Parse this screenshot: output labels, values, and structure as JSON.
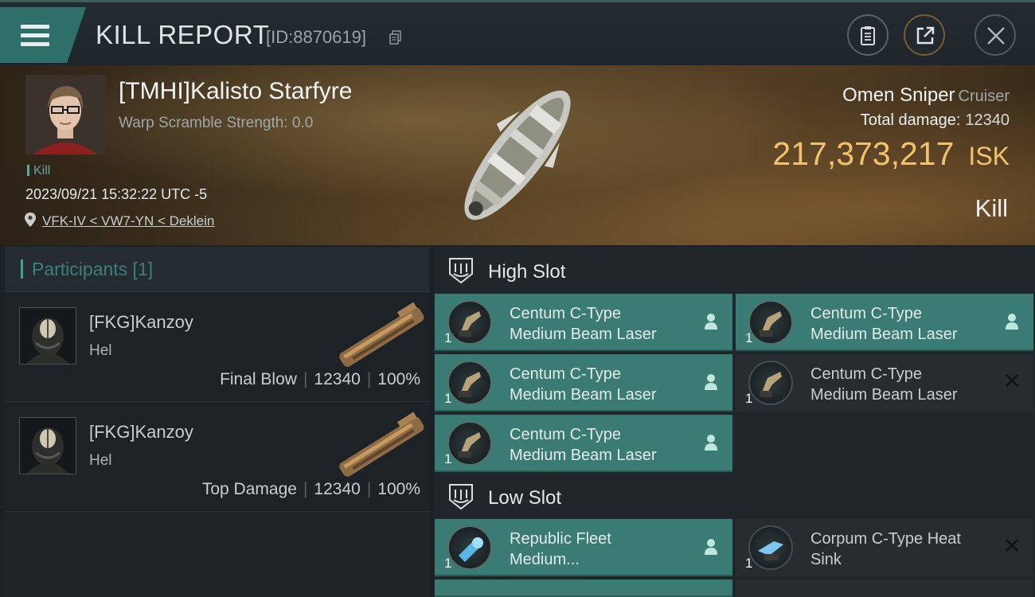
{
  "header": {
    "title": "KILL REPORT",
    "report_id": "[ID:8870619]"
  },
  "victim": {
    "name": "[TMHI]Kalisto Starfyre",
    "warp_scramble": "Warp Scramble Strength: 0.0",
    "tag": "Kill",
    "datetime": "2023/09/21 15:32:22 UTC -5",
    "location": "VFK-IV < VW7-YN < Deklein",
    "ship_name": "Omen Sniper",
    "ship_class": "Cruiser",
    "total_damage_label": "Total damage:",
    "total_damage_value": "12340",
    "isk_value": "217,373,217",
    "isk_unit": "ISK",
    "outcome": "Kill"
  },
  "participants": {
    "title": "Participants [1]",
    "items": [
      {
        "name": "[FKG]Kanzoy",
        "ship": "Hel",
        "role": "Final Blow",
        "damage": "12340",
        "percent": "100%"
      },
      {
        "name": "[FKG]Kanzoy",
        "ship": "Hel",
        "role": "Top Damage",
        "damage": "12340",
        "percent": "100%"
      }
    ]
  },
  "slots": {
    "high": {
      "title": "High Slot",
      "modules": [
        {
          "line1": "Centum C-Type",
          "line2": "Medium Beam Laser",
          "qty": "1",
          "state": "fitted"
        },
        {
          "line1": "Centum C-Type",
          "line2": "Medium Beam Laser",
          "qty": "1",
          "state": "fitted"
        },
        {
          "line1": "Centum C-Type",
          "line2": "Medium Beam Laser",
          "qty": "1",
          "state": "fitted"
        },
        {
          "line1": "Centum C-Type",
          "line2": "Medium Beam Laser",
          "qty": "1",
          "state": "destroyed"
        },
        {
          "line1": "Centum C-Type",
          "line2": "Medium Beam Laser",
          "qty": "1",
          "state": "fitted"
        }
      ]
    },
    "low": {
      "title": "Low Slot",
      "modules": [
        {
          "line1": "Republic Fleet",
          "line2": "Medium...",
          "qty": "1",
          "state": "fitted"
        },
        {
          "line1": "Corpum C-Type Heat",
          "line2": "Sink",
          "qty": "1",
          "state": "destroyed"
        }
      ]
    }
  },
  "icons": {
    "menu": "hamburger-menu-icon",
    "copy": "copy-icon",
    "clipboard": "clipboard-icon",
    "share": "share-icon",
    "close": "close-icon",
    "location": "location-pin-icon",
    "slot": "shield-icon",
    "fitted": "person-icon",
    "destroyed": "x-icon"
  },
  "colors": {
    "accent_teal": "#3a7c74",
    "isk_gold": "#f2c36b",
    "participants_title": "#3d7f7a"
  }
}
